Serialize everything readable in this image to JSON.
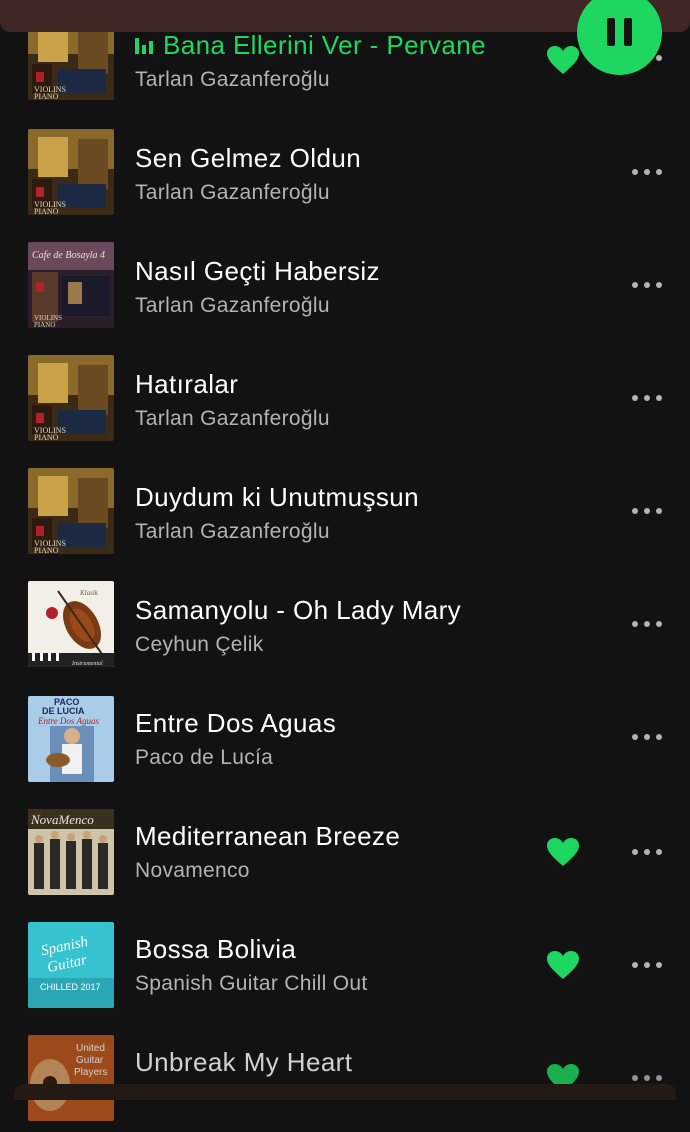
{
  "colors": {
    "accent": "#1ed760",
    "background": "#121212",
    "secondary_text": "#b3b3b3",
    "header_bar": "#3e2624"
  },
  "player": {
    "state": "playing",
    "control_icon": "pause-icon"
  },
  "tracks": [
    {
      "title": "Bana Ellerini Ver - Pervane",
      "artist": "Tarlan Gazanferoğlu",
      "playing": true,
      "liked": true,
      "art_label": "VIOLINS PIANO"
    },
    {
      "title": "Sen Gelmez Oldun",
      "artist": "Tarlan Gazanferoğlu",
      "playing": false,
      "liked": false,
      "art_label": "VIOLINS PIANO"
    },
    {
      "title": "Nasıl Geçti Habersiz",
      "artist": "Tarlan Gazanferoğlu",
      "playing": false,
      "liked": false,
      "art_label": "Cafe de Bosayla 4"
    },
    {
      "title": "Hatıralar",
      "artist": "Tarlan Gazanferoğlu",
      "playing": false,
      "liked": false,
      "art_label": "VIOLINS PIANO"
    },
    {
      "title": "Duydum ki Unutmuşsun",
      "artist": "Tarlan Gazanferoğlu",
      "playing": false,
      "liked": false,
      "art_label": "VIOLINS PIANO"
    },
    {
      "title": "Samanyolu - Oh Lady Mary",
      "artist": "Ceyhun Çelik",
      "playing": false,
      "liked": false,
      "art_label": "Klasik Instrumental"
    },
    {
      "title": "Entre Dos Aguas",
      "artist": "Paco de Lucía",
      "playing": false,
      "liked": false,
      "art_label": "PACO DE LUCIA Entre Dos Aguas"
    },
    {
      "title": "Mediterranean Breeze",
      "artist": "Novamenco",
      "playing": false,
      "liked": true,
      "art_label": "NovaMenco"
    },
    {
      "title": "Bossa Bolivia",
      "artist": "Spanish Guitar Chill Out",
      "playing": false,
      "liked": true,
      "art_label": "Spanish Guitar CHILLED 2017"
    },
    {
      "title": "Unbreak My Heart",
      "artist": "",
      "playing": false,
      "liked": true,
      "art_label": "United Guitar Players"
    }
  ]
}
